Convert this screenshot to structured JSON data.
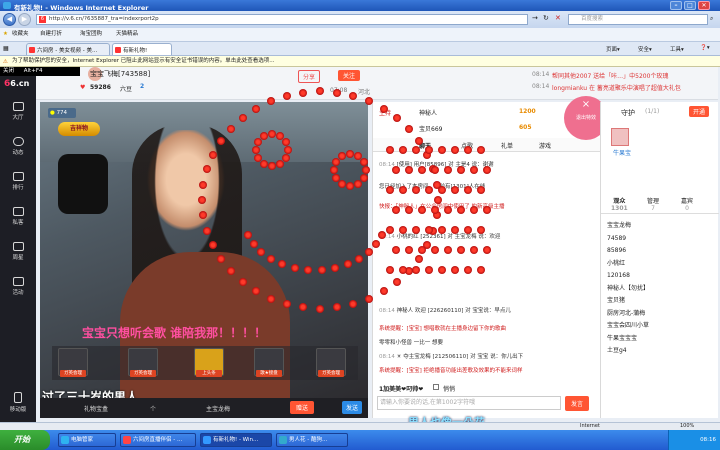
{
  "window": {
    "title": "有新礼物! - Windows Internet Explorer",
    "minimize": "–",
    "maximize": "□",
    "close": "✕"
  },
  "address": {
    "url": "http://v.6.cn/?635887_tra=indexrport2p",
    "search_placeholder": "百度搜索",
    "go": "→",
    "refresh": "↻",
    "stop": "✕"
  },
  "favorites": {
    "label": "收藏夹",
    "items": [
      "自建打折",
      "淘宝团购",
      "天猫精品"
    ]
  },
  "tabs": [
    {
      "label": "六间房 - 美女视频 - 美..."
    },
    {
      "label": "有新礼物!"
    }
  ],
  "toolbar": {
    "page": "页面▾",
    "safety": "安全▾",
    "tools": "工具▾",
    "help": "❓▾"
  },
  "infobar": {
    "text": "为了帮助保护您的安全，Internet Explorer 已阻止此网站显示有安全证书错误的内容。单击此处查看选项..."
  },
  "shortcut": {
    "close_label": "关闭",
    "keys": "Alt+F4"
  },
  "site": {
    "logo": "6.cn"
  },
  "sidebar": {
    "items": [
      "大厅",
      "动态",
      "排行",
      "私客",
      "周星",
      "活动",
      "移动版"
    ]
  },
  "anchor": {
    "name": "宝宝飞梅[743588]",
    "fans": "59286",
    "fans_label": "六豆",
    "level": "2",
    "share": "分享",
    "follow": "关注",
    "time": "07:08",
    "location": "河北"
  },
  "notices": [
    {
      "time": "08:14",
      "text": "帮同其他2007 送给「咔…」中5200个玫瑰"
    },
    {
      "time": "08:14",
      "text": "longmianku 在 蓄亮道聚乐中演唱了超值大礼包"
    }
  ],
  "video": {
    "badge": "774",
    "crest": "吉祥物",
    "subtitle_pink": "宝宝只想听会歌 谁陪我那！！！！",
    "subtitle_white": "过了三十岁的男人"
  },
  "gifts": [
    {
      "label": "ガ英会理"
    },
    {
      "label": "ガ英会理"
    },
    {
      "label": "上头条"
    },
    {
      "label": "歌★接盘"
    },
    {
      "label": "ガ英会理"
    }
  ],
  "controls": {
    "gift_label": "礼物宝盒",
    "count": "个",
    "recipient": "主宝龙梅",
    "send": "赠送",
    "send2": "发送"
  },
  "host_panel": {
    "label": "主持",
    "guard": "守护",
    "guard_count": "(1/1)",
    "open": "开通",
    "rows": [
      {
        "name": "神秘人",
        "score": "1200"
      },
      {
        "name": "宝贝669",
        "score": "605"
      }
    ]
  },
  "chat_tabs": [
    "聊天",
    "点歌",
    "礼单",
    "游戏"
  ],
  "chat": [
    {
      "time": "08:14",
      "text": "[使用] 用户[85896] 对 主是4 说：谢谢"
    },
    {
      "time": "",
      "text": "您已经加入了本房间，当前有[1301]人在线"
    },
    {
      "time": "",
      "text": "快报：「神秘人」在公会房间中使用了 的新高级主播"
    },
    {
      "time": "08:14",
      "text": "小桃的红 [252361] 对 主宝龙梅 说：欢迎"
    },
    {
      "time": "08:14",
      "text": "神秘人 欢迎 [226260110] 对 宝宝说：早点儿"
    },
    {
      "time": "",
      "text": "系统提醒：[宝宝] 想唱歌就在主播身边留下你的歌曲"
    },
    {
      "time": "",
      "text": "零零和小怪兽 一比一 想要"
    },
    {
      "time": "08:14",
      "text": "☀ 夺主宝龙梅 [212506110] 对 宝宝 说：你儿出下"
    },
    {
      "time": "",
      "text": "系统提醒：[宝宝] 拒绝播音功能出差歌及效果的不能来词样"
    }
  ],
  "chat_input": {
    "bold": "1加美美❤叼帅❤",
    "checkbox": "悄悄",
    "placeholder": "请输入你要说的话,在第1002字符哦",
    "send": "发言"
  },
  "audience": {
    "tabs": [
      {
        "label": "观众",
        "count": "1301"
      },
      {
        "label": "管理",
        "count": "7"
      },
      {
        "label": "嘉宾",
        "count": "0"
      }
    ],
    "guard_name": "牛果宝",
    "users": [
      "宝宝龙梅",
      "74589",
      "85896",
      "小桃红",
      "120168",
      "神秘人【勿扰】",
      "宝贝猪",
      "厨房河北-蒲梅",
      "宝宝会四川小草",
      "牛果宝宝宝",
      "土豆g4"
    ]
  },
  "float": {
    "button": "退出特效",
    "close": "×"
  },
  "overlay_text": "男人也像一朵花",
  "statusbar": {
    "zone": "Internet",
    "zoom": "100%"
  },
  "taskbar": {
    "start": "开始",
    "items": [
      "电脑管家",
      "六间房直播伴侣 - ...",
      "有新礼物! - Win...",
      "男人花 - 酷狗..."
    ],
    "time": "08:16"
  }
}
